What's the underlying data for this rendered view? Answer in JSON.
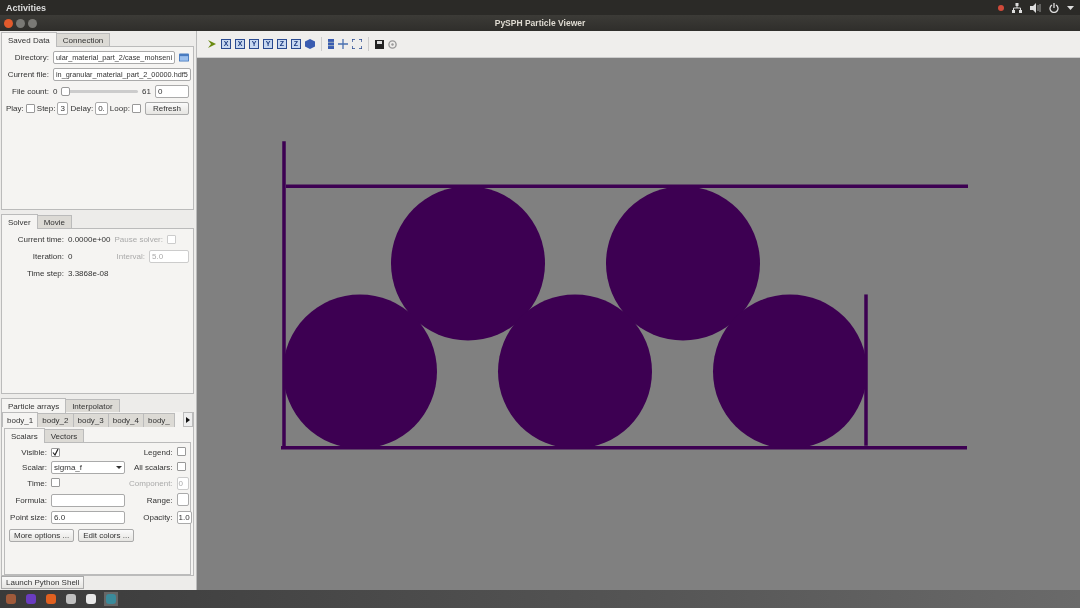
{
  "top_bar": {
    "activities": "Activities"
  },
  "window": {
    "title": "PySPH Particle Viewer"
  },
  "saved_data": {
    "tabs": [
      {
        "label": "Saved Data",
        "selected": true
      },
      {
        "label": "Connection",
        "selected": false
      }
    ],
    "directory": {
      "label": "Directory:",
      "value": "ular_material_part_2/case_mohseni"
    },
    "current_file": {
      "label": "Current file:",
      "value": "in_granular_material_part_2_00000.hdf5"
    },
    "file_count": {
      "label": "File count:",
      "min": "0",
      "max": "61",
      "level": 0,
      "value": "0"
    },
    "play": {
      "label": "Play:",
      "checked": false
    },
    "step": {
      "label": "Step:",
      "value": "3"
    },
    "delay": {
      "label": "Delay:",
      "value": "0."
    },
    "loop": {
      "label": "Loop:",
      "checked": false
    },
    "refresh": "Refresh"
  },
  "solver": {
    "tabs": [
      {
        "label": "Solver",
        "selected": true
      },
      {
        "label": "Movie",
        "selected": false
      }
    ],
    "current_time": {
      "label": "Current time:",
      "value": "0.0000e+00"
    },
    "pause_solver": {
      "label": "Pause solver:",
      "checked": false,
      "disabled": true
    },
    "iteration": {
      "label": "Iteration:",
      "value": "0"
    },
    "interval": {
      "label": "Interval:",
      "value": "5.0",
      "disabled": true
    },
    "time_step": {
      "label": "Time step:",
      "value": "3.3868e-08"
    }
  },
  "particles": {
    "tabs": [
      {
        "label": "Particle arrays",
        "selected": true
      },
      {
        "label": "Interpolator",
        "selected": false
      }
    ],
    "arrays": [
      {
        "label": "body_1",
        "selected": true
      },
      {
        "label": "body_2",
        "selected": false
      },
      {
        "label": "body_3",
        "selected": false
      },
      {
        "label": "body_4",
        "selected": false
      },
      {
        "label": "body_",
        "selected": false
      }
    ],
    "subtabs": [
      {
        "label": "Scalars",
        "selected": true
      },
      {
        "label": "Vectors",
        "selected": false
      }
    ],
    "visible": {
      "label": "Visible:",
      "checked": true
    },
    "legend": {
      "label": "Legend:",
      "checked": false
    },
    "scalar": {
      "label": "Scalar:",
      "value": "sigma_f"
    },
    "all_scalars": {
      "label": "All scalars:",
      "checked": false
    },
    "time": {
      "label": "Time:",
      "checked": false
    },
    "component": {
      "label": "Component:",
      "value": "0",
      "disabled": true
    },
    "formula": {
      "label": "Formula:"
    },
    "range": {
      "label": "Range:"
    },
    "point_size": {
      "label": "Point size:",
      "value": "6.0"
    },
    "opacity": {
      "label": "Opacity:",
      "value": "1.0"
    },
    "buttons": [
      "More options ...",
      "Edit colors ..."
    ]
  },
  "launch_shell": "Launch Python Shell",
  "toolbar": [
    {
      "kind": "arrow"
    },
    {
      "kind": "axis",
      "label": "X"
    },
    {
      "kind": "axis",
      "label": "X"
    },
    {
      "kind": "axis",
      "label": "Y"
    },
    {
      "kind": "axis",
      "label": "Y"
    },
    {
      "kind": "axis",
      "label": "Z"
    },
    {
      "kind": "axis",
      "label": "Z"
    },
    {
      "kind": "cube"
    },
    {
      "kind": "sep"
    },
    {
      "kind": "stack"
    },
    {
      "kind": "cross"
    },
    {
      "kind": "fit"
    },
    {
      "kind": "sep"
    },
    {
      "kind": "save"
    },
    {
      "kind": "gear"
    }
  ]
}
